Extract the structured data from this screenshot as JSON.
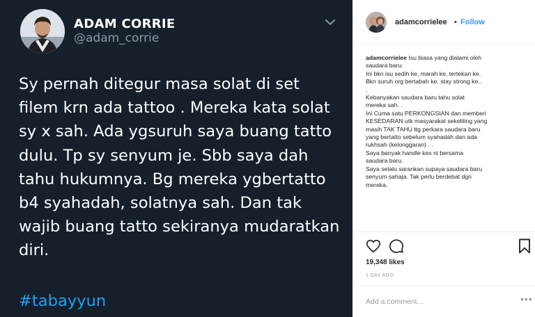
{
  "tweet": {
    "display_name": "ADAM CORRIE",
    "handle": "@adam_corrie",
    "text": "Sy pernah ditegur masa solat di set\nfilem krn ada tattoo . Mereka kata solat\nsy x sah. Ada ygsuruh saya buang tatto\ndulu. Tp sy senyum je. Sbb saya dah\ntahu hukumnya. Bg mereka ygbertatto\nb4 syahadah, solatnya sah. Dan tak\nwajib buang tatto sekiranya mudaratkan\ndiri.",
    "hashtag": "#tabayyun",
    "colors": {
      "background": "#15202b",
      "text": "#ffffff",
      "muted": "#8899a6",
      "link": "#1da1f2"
    },
    "icons": {
      "menu": "chevron-down-icon"
    }
  },
  "instagram": {
    "username": "adamcorrielee",
    "separator": "•",
    "follow_label": "Follow",
    "caption_username": "adamcorrielee",
    "caption": " Isu biasa yang dialami oleh\nsaudara baru.\nIni bkn isu sedih ke, marah ke, tertekan ke.\nBkn suruh org bertabah ke, stay strong ke..\n.\nKebanyakan saudara baru tahu solat\nmereka sah. .\nIni Cuma satu PERKONGSIAN dan memberi\nKESEDARAN utk masyarakat sekeliling yang\nmasih TAK TAHU ttg perkara saudara baru\nyang bertatto sebelum syahadah dan ada\nrukhsah (kelonggaran) . .\nSaya banyak handle kes ni bersama\nsaudara baru.\nSaya selalu sarankan supaya saudara baru\nsenyum sahaja. Tak perlu berdebat dgn\nmereka.",
    "likes": "19,348 likes",
    "timestamp": "1 DAY AGO",
    "comment_placeholder": "Add a comment...",
    "more_label": "•••",
    "colors": {
      "link": "#3897f0",
      "text": "#262626",
      "muted": "#999999",
      "border": "#efefef"
    },
    "icons": {
      "like": "heart-icon",
      "comment": "comment-icon",
      "save": "bookmark-icon",
      "more": "more-options-icon"
    }
  }
}
